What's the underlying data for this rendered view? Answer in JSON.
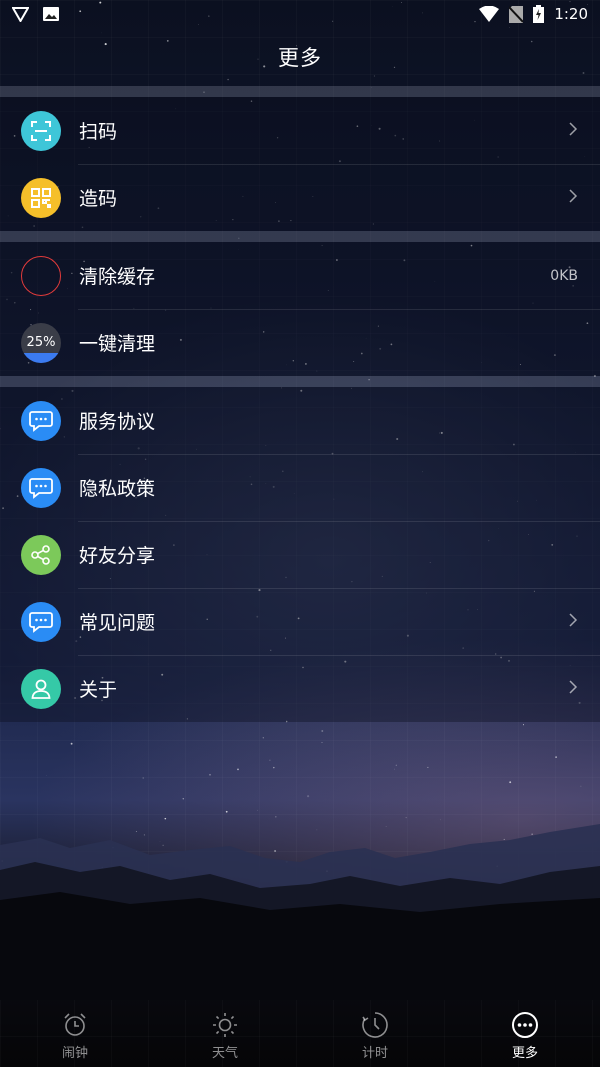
{
  "status": {
    "time": "1:20"
  },
  "header": {
    "title": "更多"
  },
  "groups": [
    {
      "items": [
        {
          "label": "扫码",
          "icon": "scan-icon",
          "color": "#3ec6d8",
          "chevron": true
        },
        {
          "label": "造码",
          "icon": "qrcode-icon",
          "color": "#f5bf2a",
          "chevron": true
        }
      ]
    },
    {
      "items": [
        {
          "label": "清除缓存",
          "icon": "cache-ring-icon",
          "color": "#e23b3b",
          "value": "0KB"
        },
        {
          "label": "一键清理",
          "icon": "memory-progress-icon",
          "color": "#3b7bf0",
          "value": "25%",
          "progress": 0.25
        }
      ]
    },
    {
      "items": [
        {
          "label": "服务协议",
          "icon": "chat-bubble-icon",
          "color": "#2a8cf5"
        },
        {
          "label": "隐私政策",
          "icon": "chat-bubble-icon",
          "color": "#2a8cf5"
        },
        {
          "label": "好友分享",
          "icon": "share-icon",
          "color": "#7cc95a"
        },
        {
          "label": "常见问题",
          "icon": "chat-bubble-icon",
          "color": "#2a8cf5",
          "chevron": true
        },
        {
          "label": "关于",
          "icon": "user-icon",
          "color": "#35c9a7",
          "chevron": true
        }
      ]
    }
  ],
  "nav": [
    {
      "label": "闹钟",
      "icon": "alarm-clock-icon",
      "active": false
    },
    {
      "label": "天气",
      "icon": "sun-icon",
      "active": false
    },
    {
      "label": "计时",
      "icon": "timer-icon",
      "active": false
    },
    {
      "label": "更多",
      "icon": "more-dots-icon",
      "active": true
    }
  ]
}
